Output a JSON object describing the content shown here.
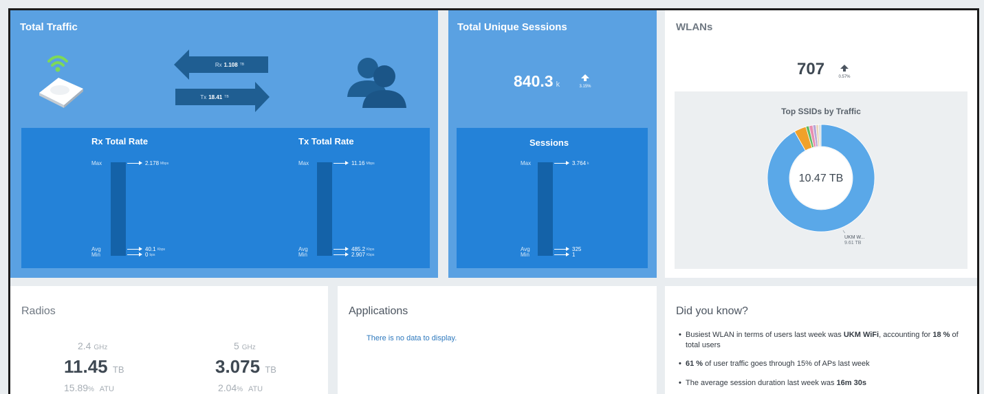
{
  "colors": {
    "panel_blue": "#5aa1e2",
    "inner_blue": "#2482d8",
    "bar_blue": "#1462a8",
    "arrow_blue": "#1f5e92",
    "donut_main": "#5aa8e8",
    "donut_orange": "#f0a12a",
    "donut_green": "#5dbb63"
  },
  "total_traffic": {
    "title": "Total Traffic",
    "rx_label": "Rx",
    "rx_value": "1.108",
    "rx_unit": "TB",
    "tx_label": "Tx",
    "tx_value": "18.41",
    "tx_unit": "TB",
    "rx_rate": {
      "title": "Rx Total Rate",
      "max_label": "Max",
      "max_value": "2.178",
      "max_unit": "Mbps",
      "avg_label": "Avg",
      "avg_value": "40.1",
      "avg_unit": "Kbps",
      "min_label": "Min",
      "min_value": "0",
      "min_unit": "bps"
    },
    "tx_rate": {
      "title": "Tx Total Rate",
      "max_label": "Max",
      "max_value": "11.16",
      "max_unit": "Mbps",
      "avg_label": "Avg",
      "avg_value": "485.2",
      "avg_unit": "Kbps",
      "min_label": "Min",
      "min_value": "2.907",
      "min_unit": "Kbps"
    }
  },
  "sessions": {
    "title": "Total Unique Sessions",
    "value": "840.3",
    "unit": "k",
    "change": "3.15%",
    "inner_title": "Sessions",
    "max_label": "Max",
    "max_value": "3.764",
    "max_unit": "k",
    "avg_label": "Avg",
    "avg_value": "325",
    "min_label": "Min",
    "min_value": "1"
  },
  "wlans": {
    "title": "WLANs",
    "value": "707",
    "change": "0.57%",
    "chart_title": "Top SSIDs by Traffic",
    "center_value": "10.47 TB",
    "callout_name": "UKM W...",
    "callout_value": "9.61 TB"
  },
  "chart_data": {
    "type": "pie",
    "title": "Top SSIDs by Traffic",
    "total": "10.47 TB",
    "series": [
      {
        "name": "UKM W...",
        "value": 9.61,
        "color": "#5aa8e8"
      },
      {
        "value": 0.38,
        "color": "#f0a12a"
      },
      {
        "value": 0.1,
        "color": "#5dbb63"
      },
      {
        "value": 0.12,
        "color": "#e88fb0"
      },
      {
        "value": 0.1,
        "color": "#b6a7d6"
      },
      {
        "value": 0.08,
        "color": "#e9d3b6"
      },
      {
        "value": 0.08,
        "color": "#d8dde2"
      }
    ]
  },
  "radios": {
    "title": "Radios",
    "bands": [
      {
        "freq": "2.4",
        "freq_unit": "GHz",
        "value": "11.45",
        "value_unit": "TB",
        "atu": "15.89",
        "atu_unit": "%",
        "atu_label": "ATU"
      },
      {
        "freq": "5",
        "freq_unit": "GHz",
        "value": "3.075",
        "value_unit": "TB",
        "atu": "2.04",
        "atu_unit": "%",
        "atu_label": "ATU"
      }
    ]
  },
  "applications": {
    "title": "Applications",
    "empty_text": "There is no data to display."
  },
  "did_you_know": {
    "title": "Did you know?",
    "item1_pre": "Busiest WLAN in terms of users last week was ",
    "item1_bold1": "UKM WiFi",
    "item1_mid": ", accounting for ",
    "item1_bold2": "18 %",
    "item1_post": " of total users",
    "item2_bold": "61 %",
    "item2_post": " of user traffic goes through 15% of APs last week",
    "item3_pre": "The average session duration last week was ",
    "item3_bold": "16m 30s"
  }
}
